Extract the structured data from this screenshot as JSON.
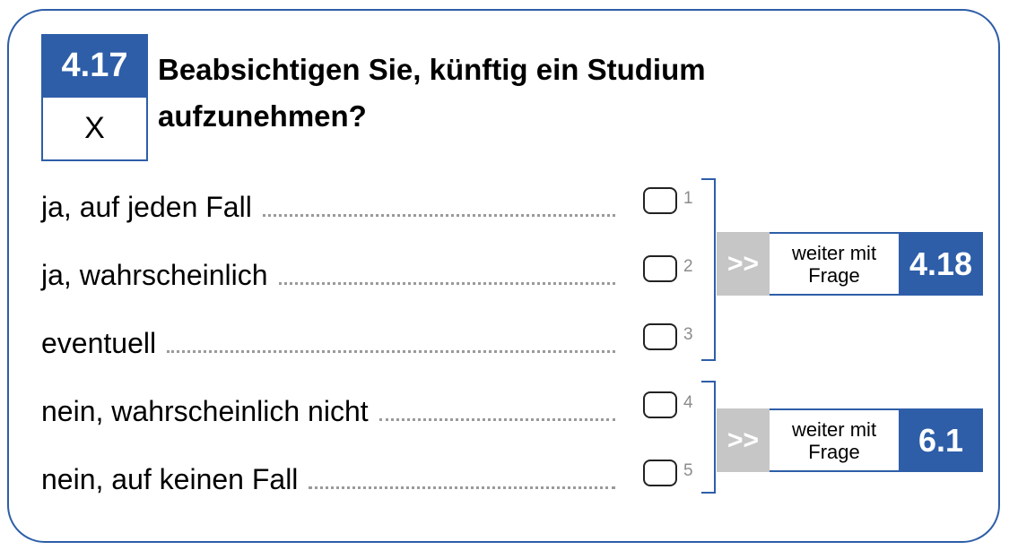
{
  "question": {
    "number": "4.17",
    "filter": "X",
    "text_line1": "Beabsichtigen Sie, künftig ein Studium",
    "text_line2": "aufzunehmen?"
  },
  "options": [
    {
      "label": "ja, auf jeden Fall",
      "code": "1"
    },
    {
      "label": "ja, wahrscheinlich",
      "code": "2"
    },
    {
      "label": "eventuell",
      "code": "3"
    },
    {
      "label": "nein, wahrscheinlich nicht",
      "code": "4"
    },
    {
      "label": "nein, auf keinen Fall",
      "code": "5"
    }
  ],
  "skips": [
    {
      "arrow": ">>",
      "text_line1": "weiter mit",
      "text_line2": "Frage",
      "target": "4.18"
    },
    {
      "arrow": ">>",
      "text_line1": "weiter mit",
      "text_line2": "Frage",
      "target": "6.1"
    }
  ],
  "colors": {
    "accent": "#2e5ea8",
    "arrow_bg": "#c6c6c6",
    "code_text": "#8c8c8c"
  }
}
